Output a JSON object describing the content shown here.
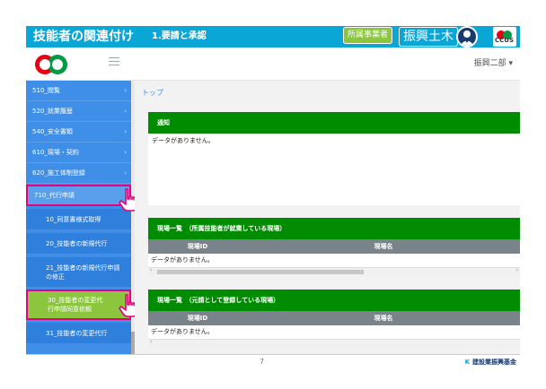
{
  "banner": {
    "title": "技能者の関連付け",
    "subtitle": "1.要請と承認",
    "affiliation_tag": "所属事業者",
    "affiliation_name": "振興土木",
    "ccus_label": "CCUS"
  },
  "header": {
    "user_menu": "振興二部 ▾"
  },
  "sidebar": {
    "items": [
      {
        "label": "510_閲覧"
      },
      {
        "label": "520_就業履歴"
      },
      {
        "label": "540_安全書類"
      },
      {
        "label": "610_現場・契約"
      },
      {
        "label": "620_施工体制登録"
      },
      {
        "label": "710_代行申請"
      }
    ],
    "subitems": [
      {
        "label": "10_同意書様式取得"
      },
      {
        "label": "20_技能者の新規代行"
      },
      {
        "label": "21_技能者の新規代行申請の修正"
      },
      {
        "label": "30_技能者の変更代行申請同意依頼"
      },
      {
        "label": "31_技能者の変更代行"
      }
    ]
  },
  "main": {
    "breadcrumb": "トップ",
    "notice": {
      "title": "通知",
      "empty": "データがありません。"
    },
    "sites_employed": {
      "title": "現場一覧　（所属技能者が就業している現場）",
      "col_id": "現場ID",
      "col_name": "現場名",
      "empty": "データがありません。"
    },
    "sites_prime": {
      "title": "現場一覧　（元請として登録している現場）",
      "col_id": "現場ID",
      "col_name": "現場名",
      "empty": "データがありません。"
    }
  },
  "footer": {
    "page_number": "7",
    "org_name": "建設業振興基金"
  },
  "colors": {
    "banner": "#0aa6d6",
    "sidebar": "#3f8fe8",
    "panel_header": "#008c00",
    "highlight": "#e4007f",
    "active_green": "#8cc63f"
  }
}
